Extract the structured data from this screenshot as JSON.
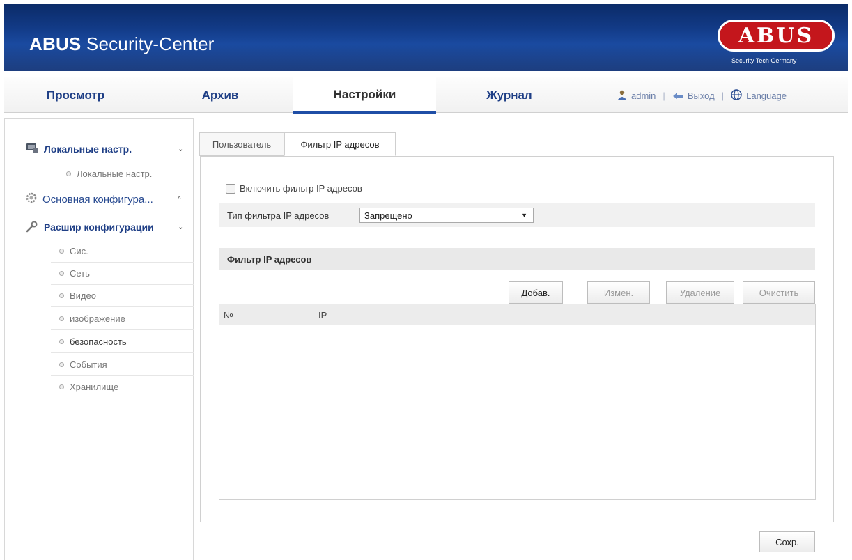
{
  "header": {
    "title_bold": "ABUS",
    "title_rest": " Security-Center",
    "logo_text": "ABUS",
    "logo_tagline": "Security Tech Germany",
    "brand_color": "#c4161c"
  },
  "nav": {
    "tabs": [
      {
        "label": "Просмотр"
      },
      {
        "label": "Архив"
      },
      {
        "label": "Настройки"
      },
      {
        "label": "Журнал"
      }
    ],
    "active_tab": "Настройки",
    "user": "admin",
    "logout": "Выход",
    "language": "Language",
    "separator": "|"
  },
  "sidebar": {
    "groups": [
      {
        "label": "Локальные настр.",
        "caret": "⌄",
        "icon": "monitor-icon"
      },
      {
        "label": "Основная конфигура...",
        "caret": "^",
        "icon": "gear-icon"
      },
      {
        "label": "Расшир конфигурации",
        "caret": "⌄",
        "icon": "wrench-icon"
      }
    ],
    "local_sub": "Локальные настр.",
    "items": [
      {
        "label": "Сис."
      },
      {
        "label": "Сеть"
      },
      {
        "label": "Видео"
      },
      {
        "label": "изображение"
      },
      {
        "label": "безопасность"
      },
      {
        "label": "События"
      },
      {
        "label": "Хранилище"
      }
    ],
    "active_item": "безопасность"
  },
  "content": {
    "tabs": [
      {
        "label": "Пользователь"
      },
      {
        "label": "Фильтр IP адресов"
      }
    ],
    "active_tab": "Фильтр IP адресов",
    "enable_label": "Включить фильтр IP адресов",
    "enable_checked": false,
    "type_label": "Тип фильтра IP адресов",
    "type_value": "Запрещено",
    "section_title": "Фильтр IP адресов",
    "buttons": {
      "add": "Добав.",
      "edit": "Измен.",
      "delete": "Удаление",
      "clear": "Очистить"
    },
    "table": {
      "col_no": "№",
      "col_ip": "IP",
      "rows": []
    },
    "save": "Сохр."
  }
}
